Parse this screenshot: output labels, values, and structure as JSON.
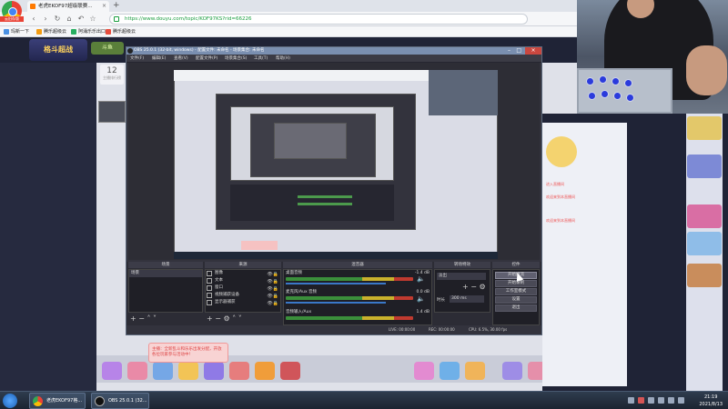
{
  "browser": {
    "tab_title": "老虎EKOF97超级联赛...",
    "tab_close": "×",
    "new_tab": "+",
    "badge": "云旧存版",
    "url": "https://www.douyu.com/topic/KOF97KS?rid=66226",
    "nav": {
      "back": "‹",
      "forward": "›",
      "reload": "↻",
      "home": "⌂",
      "undo": "↶",
      "star": "☆"
    },
    "bookmarks": [
      "玛新一下",
      "腾乐超级云",
      "阿涌乐乐出口",
      "腾乐超级云"
    ]
  },
  "page": {
    "logo": "格斗超战",
    "logo2": "斗鱼",
    "rank_number": "12",
    "rank_label": "主播排行榜",
    "promo": "主播：全新乱斗和乐乐出发分配，开放各位玩家参与活动中！",
    "chat_lines": [
      "进入直播间",
      "欢迎来到本直播间",
      "欢迎来到本直播间"
    ]
  },
  "obs": {
    "title": "OBS 25.0.1 (32-bit, windows) - 配置文件: 未命名 - 场景集合: 未命名",
    "menu": [
      "文件(F)",
      "编辑(E)",
      "查看(V)",
      "配置文件(P)",
      "场景集合(S)",
      "工具(T)",
      "帮助(H)"
    ],
    "docks": {
      "scenes": "场景",
      "sources": "来源",
      "mixer": "混音器",
      "transitions": "转场特效",
      "controls": "控件"
    },
    "scene_items": [
      "场景"
    ],
    "source_items": [
      "图像",
      "文本",
      "窗口",
      "视频捕获设备",
      "显示器捕获"
    ],
    "mixer": [
      {
        "name": "桌面音频",
        "db": "-1.4 dB",
        "level": 0.78
      },
      {
        "name": "麦克风/Aux 音频",
        "db": "0.0 dB",
        "level": 0.55
      },
      {
        "name": "音频输入/Aux",
        "db": "1.4 dB",
        "level": 0.4
      }
    ],
    "transition": {
      "type": "淡出",
      "duration_label": "时长",
      "duration_value": "300 ms"
    },
    "controls": [
      "开始推流",
      "开始录制",
      "工作室模式",
      "设置",
      "退出"
    ],
    "status": {
      "live": "LIVE: 00:00:00",
      "rec": "REC: 00:00:00",
      "cpu": "CPU: 6.5%, 30.00 fps"
    }
  },
  "taskbar": {
    "tasks": [
      "老虎EKOF97格...",
      "OBS 25.0.1 (32..."
    ],
    "time": "21:19",
    "date": "2021/8/13"
  }
}
